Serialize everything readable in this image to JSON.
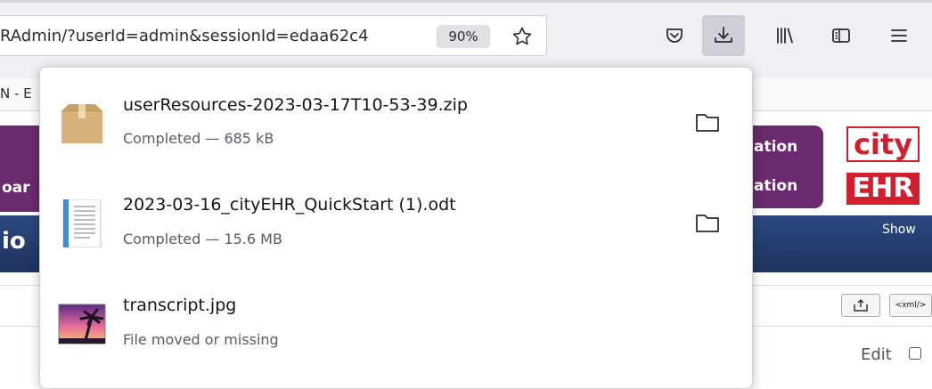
{
  "toolbar": {
    "url": "RAdmin/?userId=admin&sessionId=edaa62c4",
    "zoom": "90%",
    "tab_partial_label": "N - E"
  },
  "page": {
    "left_band_partial": "oar",
    "right_band_line1": "ation",
    "right_band_line2": "ation",
    "logo_top": "city",
    "logo_bottom": "EHR",
    "blue_band_partial": "io",
    "show_link": "Show",
    "xml_button": "<xml/>",
    "edit_label": "Edit"
  },
  "downloads": {
    "items": [
      {
        "name": "userResources-2023-03-17T10-53-39.zip",
        "status": "Completed — 685 kB",
        "icon": "archive-icon"
      },
      {
        "name": "2023-03-16_cityEHR_QuickStart (1).odt",
        "status": "Completed — 15.6 MB",
        "icon": "document-icon"
      },
      {
        "name": "transcript.jpg",
        "status": "File moved or missing",
        "icon": "image-icon"
      }
    ]
  }
}
